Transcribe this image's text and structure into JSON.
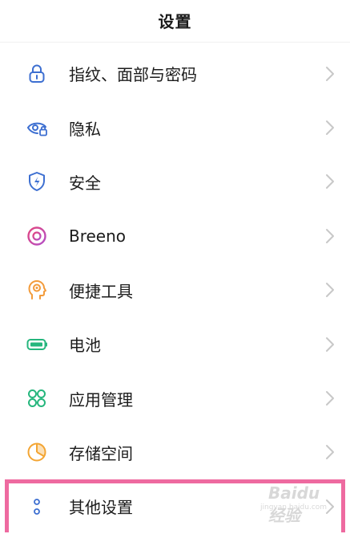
{
  "header": {
    "title": "设置"
  },
  "settings": {
    "items": [
      {
        "label": "指纹、面部与密码",
        "icon": "lock-icon",
        "color": "#3d6fd1"
      },
      {
        "label": "隐私",
        "icon": "privacy-eye-icon",
        "color": "#3d6fd1"
      },
      {
        "label": "安全",
        "icon": "security-shield-icon",
        "color": "#3d6fd1"
      },
      {
        "label": "Breeno",
        "icon": "breeno-ring-icon",
        "color": "#d14bb8"
      },
      {
        "label": "便捷工具",
        "icon": "smart-assistant-icon",
        "color": "#f39b3a"
      },
      {
        "label": "电池",
        "icon": "battery-icon",
        "color": "#25b67d"
      },
      {
        "label": "应用管理",
        "icon": "app-grid-icon",
        "color": "#25b67d"
      },
      {
        "label": "存储空间",
        "icon": "storage-pie-icon",
        "color": "#f3a533"
      },
      {
        "label": "其他设置",
        "icon": "more-dots-icon",
        "color": "#3d6fd1"
      }
    ]
  },
  "highlight": {
    "color": "#ee6aa0"
  },
  "watermark": {
    "text": "Baidu经验",
    "sub": "jingyan.baidu.com"
  }
}
